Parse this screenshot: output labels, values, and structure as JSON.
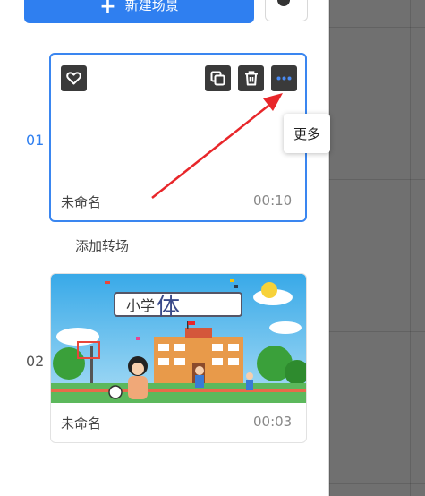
{
  "toolbar": {
    "new_scene_label": "新建场景",
    "new_scene_icon": "plus-icon",
    "music_icon": "music-note-icon"
  },
  "scenes": [
    {
      "number": "01",
      "name": "未命名",
      "duration": "00:10",
      "selected": true,
      "tools": [
        "heart-icon",
        "copy-icon",
        "trash-icon",
        "more-icon"
      ]
    },
    {
      "number": "02",
      "name": "未命名",
      "duration": "00:03",
      "selected": false,
      "thumbnail_title_part1": "小学",
      "thumbnail_title_part2": "体"
    }
  ],
  "tooltip": {
    "text": "更多"
  },
  "transition": {
    "label": "添加转场"
  },
  "colors": {
    "accent": "#2f7ff0",
    "workspace": "#707070",
    "annotation_arrow": "#e8262a"
  }
}
